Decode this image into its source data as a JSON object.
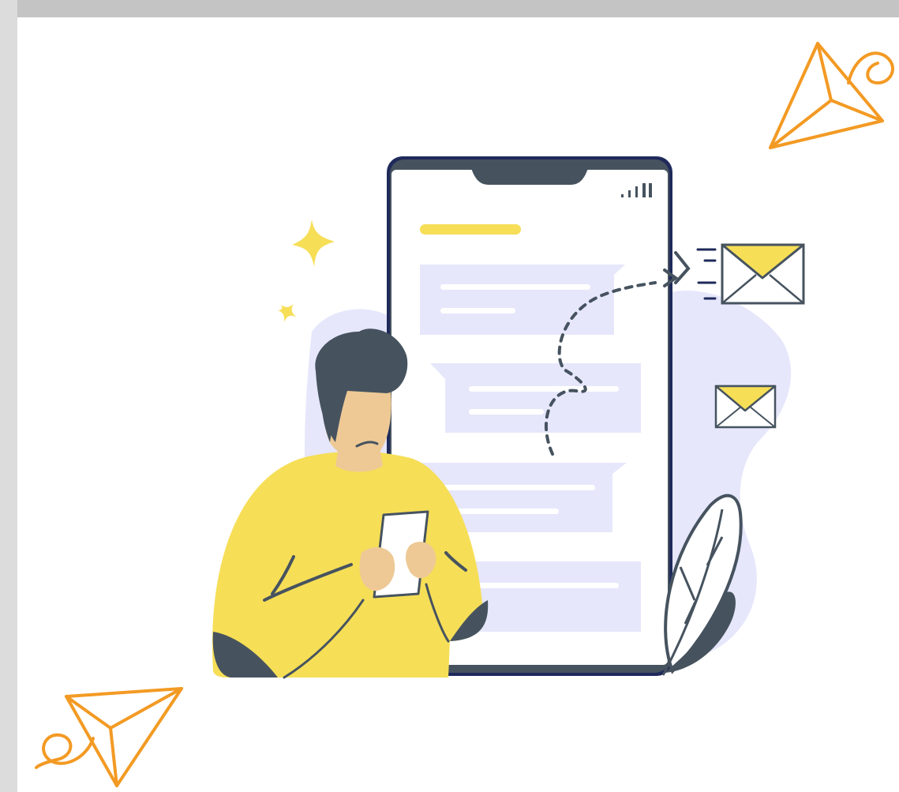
{
  "colors": {
    "frame_top": "#c4c4c4",
    "frame_left": "#dcdcdc",
    "background": "#ffffff",
    "dark": "#46535f",
    "yellow": "#f6de57",
    "orange": "#f39a24",
    "lavender": "#e6e7fb",
    "skin": "#eec995",
    "navy": "#1f2a5a"
  },
  "phone": {
    "signal_icon": "signal-bars-icon"
  },
  "icons": {
    "envelope": "envelope-icon",
    "paper_plane": "paper-plane-icon",
    "sparkle": "sparkle-icon",
    "leaf": "leaf-icon"
  }
}
